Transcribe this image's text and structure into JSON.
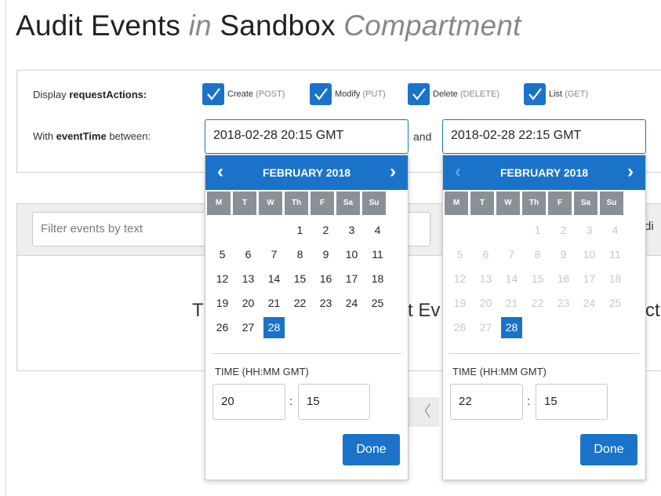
{
  "page": {
    "title_main": "Audit Events",
    "title_in": "in",
    "title_sandbox": "Sandbox",
    "title_compartment": "Compartment"
  },
  "filters": {
    "display_label": "Display",
    "display_field": "requestActions:",
    "actions": [
      {
        "label": "Create",
        "method": "(POST)",
        "checked": true
      },
      {
        "label": "Modify",
        "method": "(PUT)",
        "checked": true
      },
      {
        "label": "Delete",
        "method": "(DELETE)",
        "checked": true
      },
      {
        "label": "List",
        "method": "(GET)",
        "checked": true
      }
    ],
    "with_label": "With",
    "event_field": "eventTime",
    "between_label": "between:",
    "start_value": "2018-02-28 20:15 GMT",
    "and_label": "and",
    "end_value": "2018-02-28 22:15 GMT"
  },
  "events": {
    "filter_placeholder": "Filter events by text",
    "peek_text_left": "T",
    "peek_text_mid": "t Ev",
    "peek_text_right": "ct",
    "peek_header_right": "di",
    "pager_prev": "〈"
  },
  "date_pickers": [
    {
      "month_label": "FEBRUARY 2018",
      "prev": "‹",
      "next": "›",
      "weekdays": [
        "M",
        "T",
        "W",
        "Th",
        "F",
        "Sa",
        "Su"
      ],
      "weeks": [
        [
          "",
          "",
          "",
          "1",
          "2",
          "3",
          "4"
        ],
        [
          "5",
          "6",
          "7",
          "8",
          "9",
          "10",
          "11"
        ],
        [
          "12",
          "13",
          "14",
          "15",
          "16",
          "17",
          "18"
        ],
        [
          "19",
          "20",
          "21",
          "22",
          "23",
          "24",
          "25"
        ],
        [
          "26",
          "27",
          "28",
          "",
          "",
          "",
          ""
        ]
      ],
      "selected_day": "28",
      "time_label": "TIME (HH:MM GMT)",
      "hour": "20",
      "minute": "15",
      "done_label": "Done",
      "prev_disabled": false
    },
    {
      "month_label": "FEBRUARY 2018",
      "prev": "‹",
      "next": "›",
      "weekdays": [
        "M",
        "T",
        "W",
        "Th",
        "F",
        "Sa",
        "Su"
      ],
      "weeks": [
        [
          "",
          "",
          "",
          "1",
          "2",
          "3",
          "4"
        ],
        [
          "5",
          "6",
          "7",
          "8",
          "9",
          "10",
          "11"
        ],
        [
          "12",
          "13",
          "14",
          "15",
          "16",
          "17",
          "18"
        ],
        [
          "19",
          "20",
          "21",
          "22",
          "23",
          "24",
          "25"
        ],
        [
          "26",
          "27",
          "28",
          "",
          "",
          "",
          ""
        ]
      ],
      "selected_day": "28",
      "time_label": "TIME (HH:MM GMT)",
      "hour": "22",
      "minute": "15",
      "done_label": "Done",
      "prev_disabled": true
    }
  ],
  "colors": {
    "accent": "#1a73c9",
    "weekday_header": "#8a9196",
    "panel_border": "#cfcfcf",
    "header_bg": "#eef0f0"
  },
  "icons": {
    "checkbox": "checkmark-icon",
    "prev": "chevron-left-icon",
    "next": "chevron-right-icon"
  }
}
